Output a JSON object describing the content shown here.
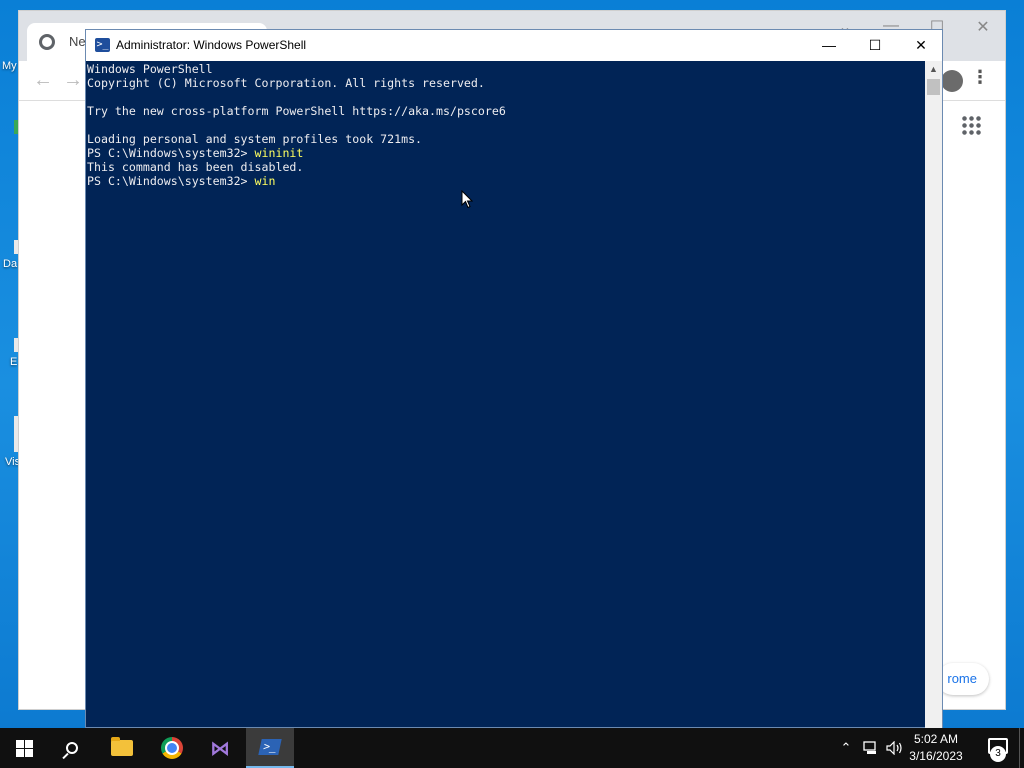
{
  "desktop": {
    "icon_labels": [
      "My",
      "Da",
      "E",
      "Vis"
    ]
  },
  "chrome": {
    "tab_title": "New",
    "customize_label": "rome",
    "caption_min": "—",
    "caption_max": "☐",
    "caption_close": "✕",
    "caption_down": "⌄"
  },
  "powershell": {
    "title": "Administrator: Windows PowerShell",
    "title_icon": ">_",
    "btn_minimize": "—",
    "btn_maximize": "☐",
    "btn_close": "✕",
    "lines": [
      {
        "text": "Windows PowerShell"
      },
      {
        "text": "Copyright (C) Microsoft Corporation. All rights reserved."
      },
      {
        "text": ""
      },
      {
        "text": "Try the new cross-platform PowerShell https://aka.ms/pscore6"
      },
      {
        "text": ""
      },
      {
        "text": "Loading personal and system profiles took 721ms."
      },
      {
        "prompt": "PS C:\\Windows\\system32> ",
        "cmd": "wininit"
      },
      {
        "text": "This command has been disabled."
      },
      {
        "prompt": "PS C:\\Windows\\system32> ",
        "cmd": "win"
      }
    ]
  },
  "taskbar": {
    "apps": [
      {
        "name": "start-button",
        "icon": "windows-logo-icon"
      },
      {
        "name": "search-button",
        "icon": "search-icon"
      },
      {
        "name": "file-explorer-button",
        "icon": "folder-icon"
      },
      {
        "name": "chrome-button",
        "icon": "chrome-icon"
      },
      {
        "name": "visual-studio-button",
        "icon": "visual-studio-icon"
      },
      {
        "name": "powershell-button",
        "icon": "powershell-icon"
      }
    ],
    "tray_chevron": "⌃",
    "time": "5:02 AM",
    "date": "3/16/2023",
    "notification_count": "3"
  },
  "colors": {
    "console_bg": "#012456",
    "console_fg": "#eeedf0",
    "command_fg": "#ffff60",
    "desktop_bg": "#0a7fd6",
    "taskbar_bg": "#101010"
  }
}
